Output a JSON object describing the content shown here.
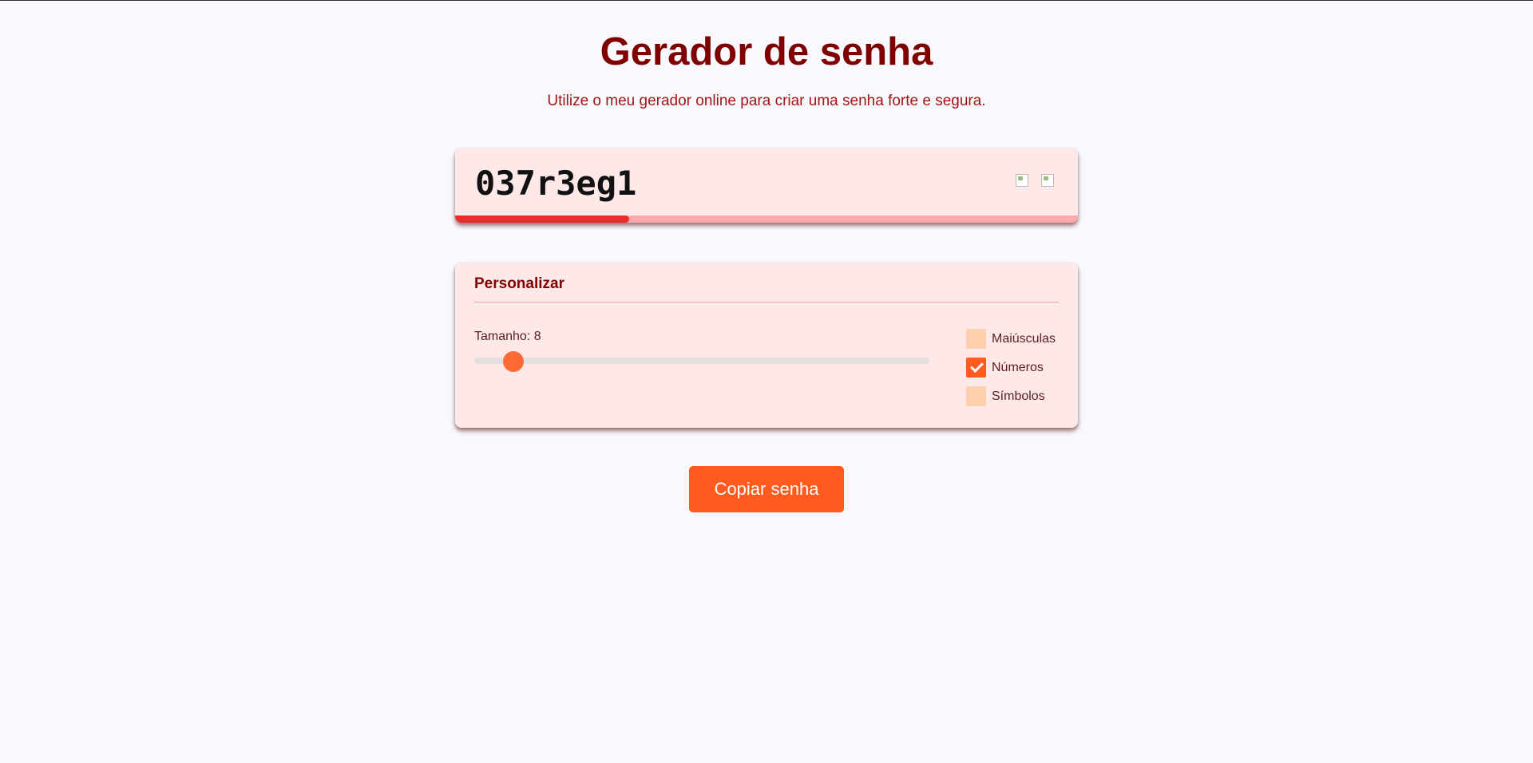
{
  "header": {
    "title": "Gerador de senha",
    "subtitle": "Utilize o meu gerador online para criar uma senha forte e segura."
  },
  "password": {
    "value": "037r3eg1",
    "strength_fraction": 0.28,
    "refresh_icon": "refresh-icon",
    "copy_icon": "copy-icon"
  },
  "customize": {
    "title": "Personalizar",
    "length_label": "Tamanho: 8",
    "length_value": 8,
    "length_min": 4,
    "length_max": 64,
    "options": [
      {
        "label": "Maiúsculas",
        "checked": false
      },
      {
        "label": "Números",
        "checked": true
      },
      {
        "label": "Símbolos",
        "checked": false
      }
    ]
  },
  "actions": {
    "copy_label": "Copiar senha"
  },
  "colors": {
    "title": "#800000",
    "accent": "#ff5a1f",
    "card_background": "#ffe8e8",
    "strength_weak": "#ee2a2a"
  }
}
